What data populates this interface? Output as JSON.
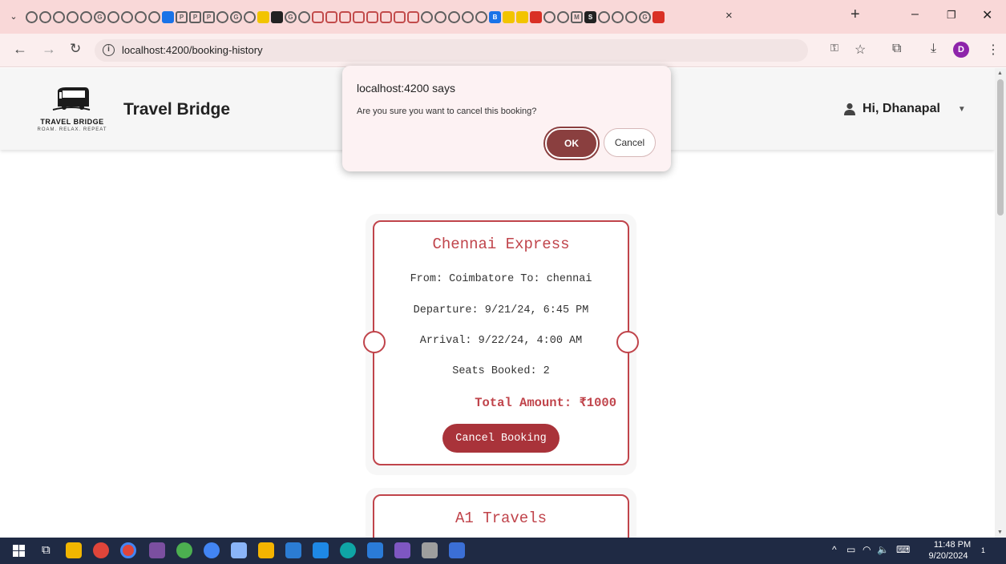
{
  "browser": {
    "url": "localhost:4200/booking-history",
    "tab_close_glyph": "×",
    "new_tab_glyph": "+",
    "favicon_letters": [
      "G",
      "P",
      "P",
      "P",
      "G",
      "G",
      "B",
      "M",
      "S",
      "G"
    ],
    "profile_initial": "D"
  },
  "header": {
    "logo_name": "TRAVEL BRIDGE",
    "logo_tagline": "ROAM. RELAX. REPEAT",
    "brand_title": "Travel Bridge",
    "user_greeting": "Hi, Dhanapal"
  },
  "bookings": [
    {
      "bus_name": "Chennai Express",
      "route": "From: Coimbatore To: chennai",
      "departure": "Departure: 9/21/24, 6:45 PM",
      "arrival": "Arrival: 9/22/24, 4:00 AM",
      "seats": "Seats Booked: 2",
      "total": "Total Amount: ₹1000",
      "cancel_label": "Cancel Booking"
    },
    {
      "bus_name": "A1 Travels"
    }
  ],
  "dialog": {
    "title": "localhost:4200 says",
    "message": "Are you sure you want to cancel this booking?",
    "ok_label": "OK",
    "cancel_label": "Cancel"
  },
  "taskbar": {
    "time": "11:48 PM",
    "date": "9/20/2024",
    "notification_count": "1"
  },
  "colors": {
    "accent": "#c0444b",
    "button": "#a9333a",
    "dialog_ok": "#8a3f3f",
    "tabstrip": "#f9d8d8",
    "taskbar": "#1f2a44"
  }
}
